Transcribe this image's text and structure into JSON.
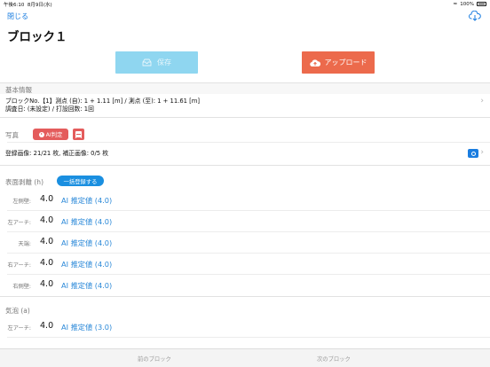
{
  "status_bar": {
    "time": "午後6:10",
    "date": "8月9日(水)",
    "battery": "100%"
  },
  "nav": {
    "close_label": "閉じる",
    "download_icon": "cloud-download-icon"
  },
  "title": "ブロック１",
  "actions": {
    "save_label": "保存",
    "upload_label": "アップロード"
  },
  "colors": {
    "accent": "#1a7de0",
    "save_disabled": "#8fd6f0",
    "upload": "#ec6a4c",
    "chip": "#e45c5c"
  },
  "basic_info": {
    "header": "基本情報",
    "line1": "ブロックNo.【1】測点 (自): 1 + 1.11 [m] / 測点 (至): 1 + 11.61 [m]",
    "line2": "調査日: (未設定) / 打設回数: 1回"
  },
  "photo": {
    "header": "写真",
    "ai_button": "AI判定",
    "registered": "登録画像: 21/21 枚, 補正画像: 0/5 枚"
  },
  "surface_peeling": {
    "header": "表面剥離 (h)",
    "bulk_label": "一括登録する",
    "rows": [
      {
        "label": "左側壁:",
        "value": "4.0",
        "ai": "AI 推定値 (4.0)"
      },
      {
        "label": "左アーチ:",
        "value": "4.0",
        "ai": "AI 推定値 (4.0)"
      },
      {
        "label": "天端:",
        "value": "4.0",
        "ai": "AI 推定値 (4.0)"
      },
      {
        "label": "右アーチ:",
        "value": "4.0",
        "ai": "AI 推定値 (4.0)"
      },
      {
        "label": "右側壁:",
        "value": "4.0",
        "ai": "AI 推定値 (4.0)"
      }
    ]
  },
  "bubbles": {
    "header": "気泡 (a)",
    "rows": [
      {
        "label": "左アーチ:",
        "value": "4.0",
        "ai": "AI 推定値 (3.0)"
      }
    ]
  },
  "toolbar": {
    "prev_label": "前のブロック",
    "next_label": "次のブロック"
  }
}
